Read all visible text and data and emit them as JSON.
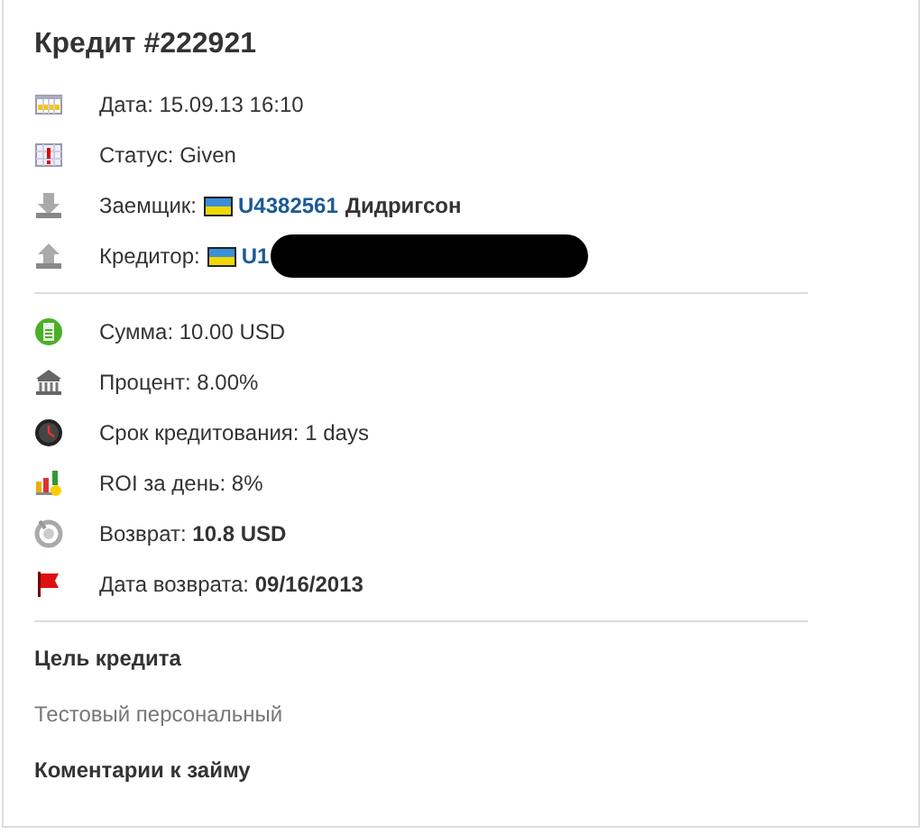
{
  "title": "Кредит #222921",
  "groups": [
    {
      "rows": [
        {
          "kind": "text",
          "text": "Дата: 15.09.13 16:10"
        },
        {
          "kind": "text",
          "text": "Статус: Given"
        },
        {
          "kind": "user",
          "label": "Заемщик:",
          "user_id": "U4382561",
          "user_name": "Дидригсон",
          "redacted": false
        },
        {
          "kind": "user",
          "label": "Кредитор:",
          "user_id": "U1",
          "redacted": true
        }
      ]
    },
    {
      "rows": [
        {
          "kind": "text",
          "text": "Сумма: 10.00 USD"
        },
        {
          "kind": "text",
          "text": "Процент: 8.00%"
        },
        {
          "kind": "text",
          "text": "Срок кредитования: 1 days"
        },
        {
          "kind": "text",
          "text": "ROI за день: 8%"
        },
        {
          "kind": "text",
          "text": "Возврат: **10.8 USD**"
        },
        {
          "kind": "text",
          "text": "Дата возврата: **09/16/2013**"
        }
      ]
    }
  ],
  "purpose": {
    "heading": "Цель кредита",
    "text": "Тестовый персональный"
  },
  "comments": {
    "heading": "Коментарии к займу"
  }
}
